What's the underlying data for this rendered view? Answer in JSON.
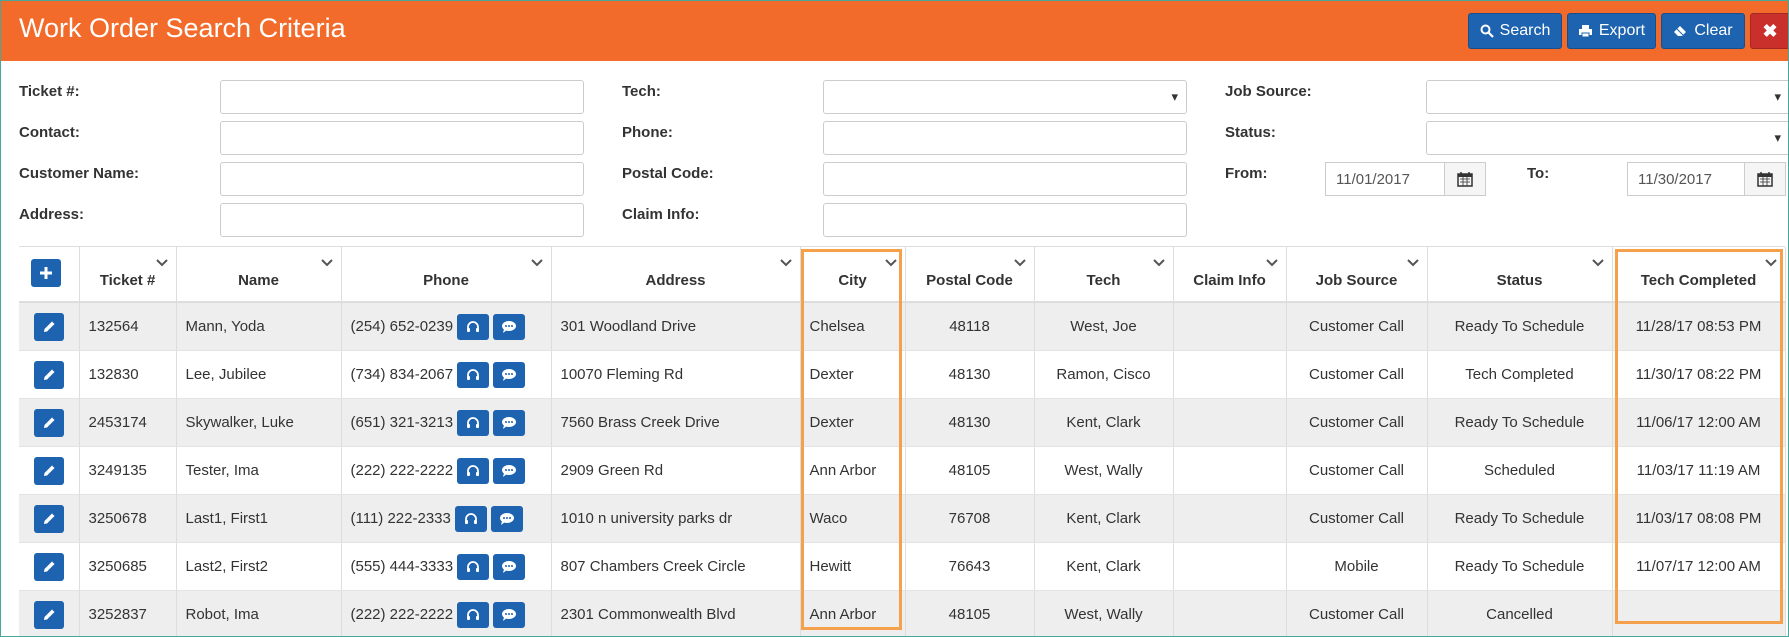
{
  "header": {
    "title": "Work Order Search Criteria",
    "search_label": "Search",
    "export_label": "Export",
    "clear_label": "Clear",
    "close_label": "✖",
    "color": "#f26b2b"
  },
  "form": {
    "ticket_label": "Ticket #:",
    "contact_label": "Contact:",
    "customer_name_label": "Customer Name:",
    "address_label": "Address:",
    "tech_label": "Tech:",
    "phone_label": "Phone:",
    "postal_code_label": "Postal Code:",
    "claim_info_label": "Claim Info:",
    "job_source_label": "Job Source:",
    "status_label": "Status:",
    "from_label": "From:",
    "to_label": "To:",
    "from_value": "11/01/2017",
    "to_value": "11/30/2017"
  },
  "table": {
    "columns": [
      "Ticket #",
      "Name",
      "Phone",
      "Address",
      "City",
      "Postal Code",
      "Tech",
      "Claim Info",
      "Job Source",
      "Status",
      "Tech Completed"
    ],
    "rows": [
      {
        "ticket": "132564",
        "name": "Mann, Yoda",
        "phone": "(254) 652-0239",
        "address": "301 Woodland Drive",
        "city": "Chelsea",
        "postal": "48118",
        "tech": "West, Joe",
        "claim": "",
        "source": "Customer Call",
        "status": "Ready To Schedule",
        "completed": "11/28/17 08:53 PM"
      },
      {
        "ticket": "132830",
        "name": "Lee, Jubilee",
        "phone": "(734) 834-2067",
        "address": "10070 Fleming Rd",
        "city": "Dexter",
        "postal": "48130",
        "tech": "Ramon, Cisco",
        "claim": "",
        "source": "Customer Call",
        "status": "Tech Completed",
        "completed": "11/30/17 08:22 PM"
      },
      {
        "ticket": "2453174",
        "name": "Skywalker, Luke",
        "phone": "(651) 321-3213",
        "address": "7560 Brass Creek Drive",
        "city": "Dexter",
        "postal": "48130",
        "tech": "Kent, Clark",
        "claim": "",
        "source": "Customer Call",
        "status": "Ready To Schedule",
        "completed": "11/06/17 12:00 AM"
      },
      {
        "ticket": "3249135",
        "name": "Tester, Ima",
        "phone": "(222) 222-2222",
        "address": "2909 Green Rd",
        "city": "Ann Arbor",
        "postal": "48105",
        "tech": "West, Wally",
        "claim": "",
        "source": "Customer Call",
        "status": "Scheduled",
        "completed": "11/03/17 11:19 AM"
      },
      {
        "ticket": "3250678",
        "name": "Last1, First1",
        "phone": "(111) 222-2333",
        "address": "1010 n university parks dr",
        "city": "Waco",
        "postal": "76708",
        "tech": "Kent, Clark",
        "claim": "",
        "source": "Customer Call",
        "status": "Ready To Schedule",
        "completed": "11/03/17 08:08 PM"
      },
      {
        "ticket": "3250685",
        "name": "Last2, First2",
        "phone": "(555) 444-3333",
        "address": "807 Chambers Creek Circle",
        "city": "Hewitt",
        "postal": "76643",
        "tech": "Kent, Clark",
        "claim": "",
        "source": "Mobile",
        "status": "Ready To Schedule",
        "completed": "11/07/17 12:00 AM"
      },
      {
        "ticket": "3252837",
        "name": "Robot, Ima",
        "phone": "(222) 222-2222",
        "address": "2301 Commonwealth Blvd",
        "city": "Ann Arbor",
        "postal": "48105",
        "tech": "West, Wally",
        "claim": "",
        "source": "Customer Call",
        "status": "Cancelled",
        "completed": ""
      }
    ]
  },
  "icons": {
    "search": "search-icon",
    "export": "print-icon",
    "clear": "eraser-icon",
    "close": "close-icon",
    "add": "plus-icon",
    "edit": "pencil-icon",
    "call": "headset-icon",
    "message": "chat-icon",
    "calendar": "calendar-icon",
    "sort": "chevron-down-icon"
  },
  "colors": {
    "button": "#1d63b0",
    "highlight": "#f5a04a",
    "close": "#c9302c"
  }
}
